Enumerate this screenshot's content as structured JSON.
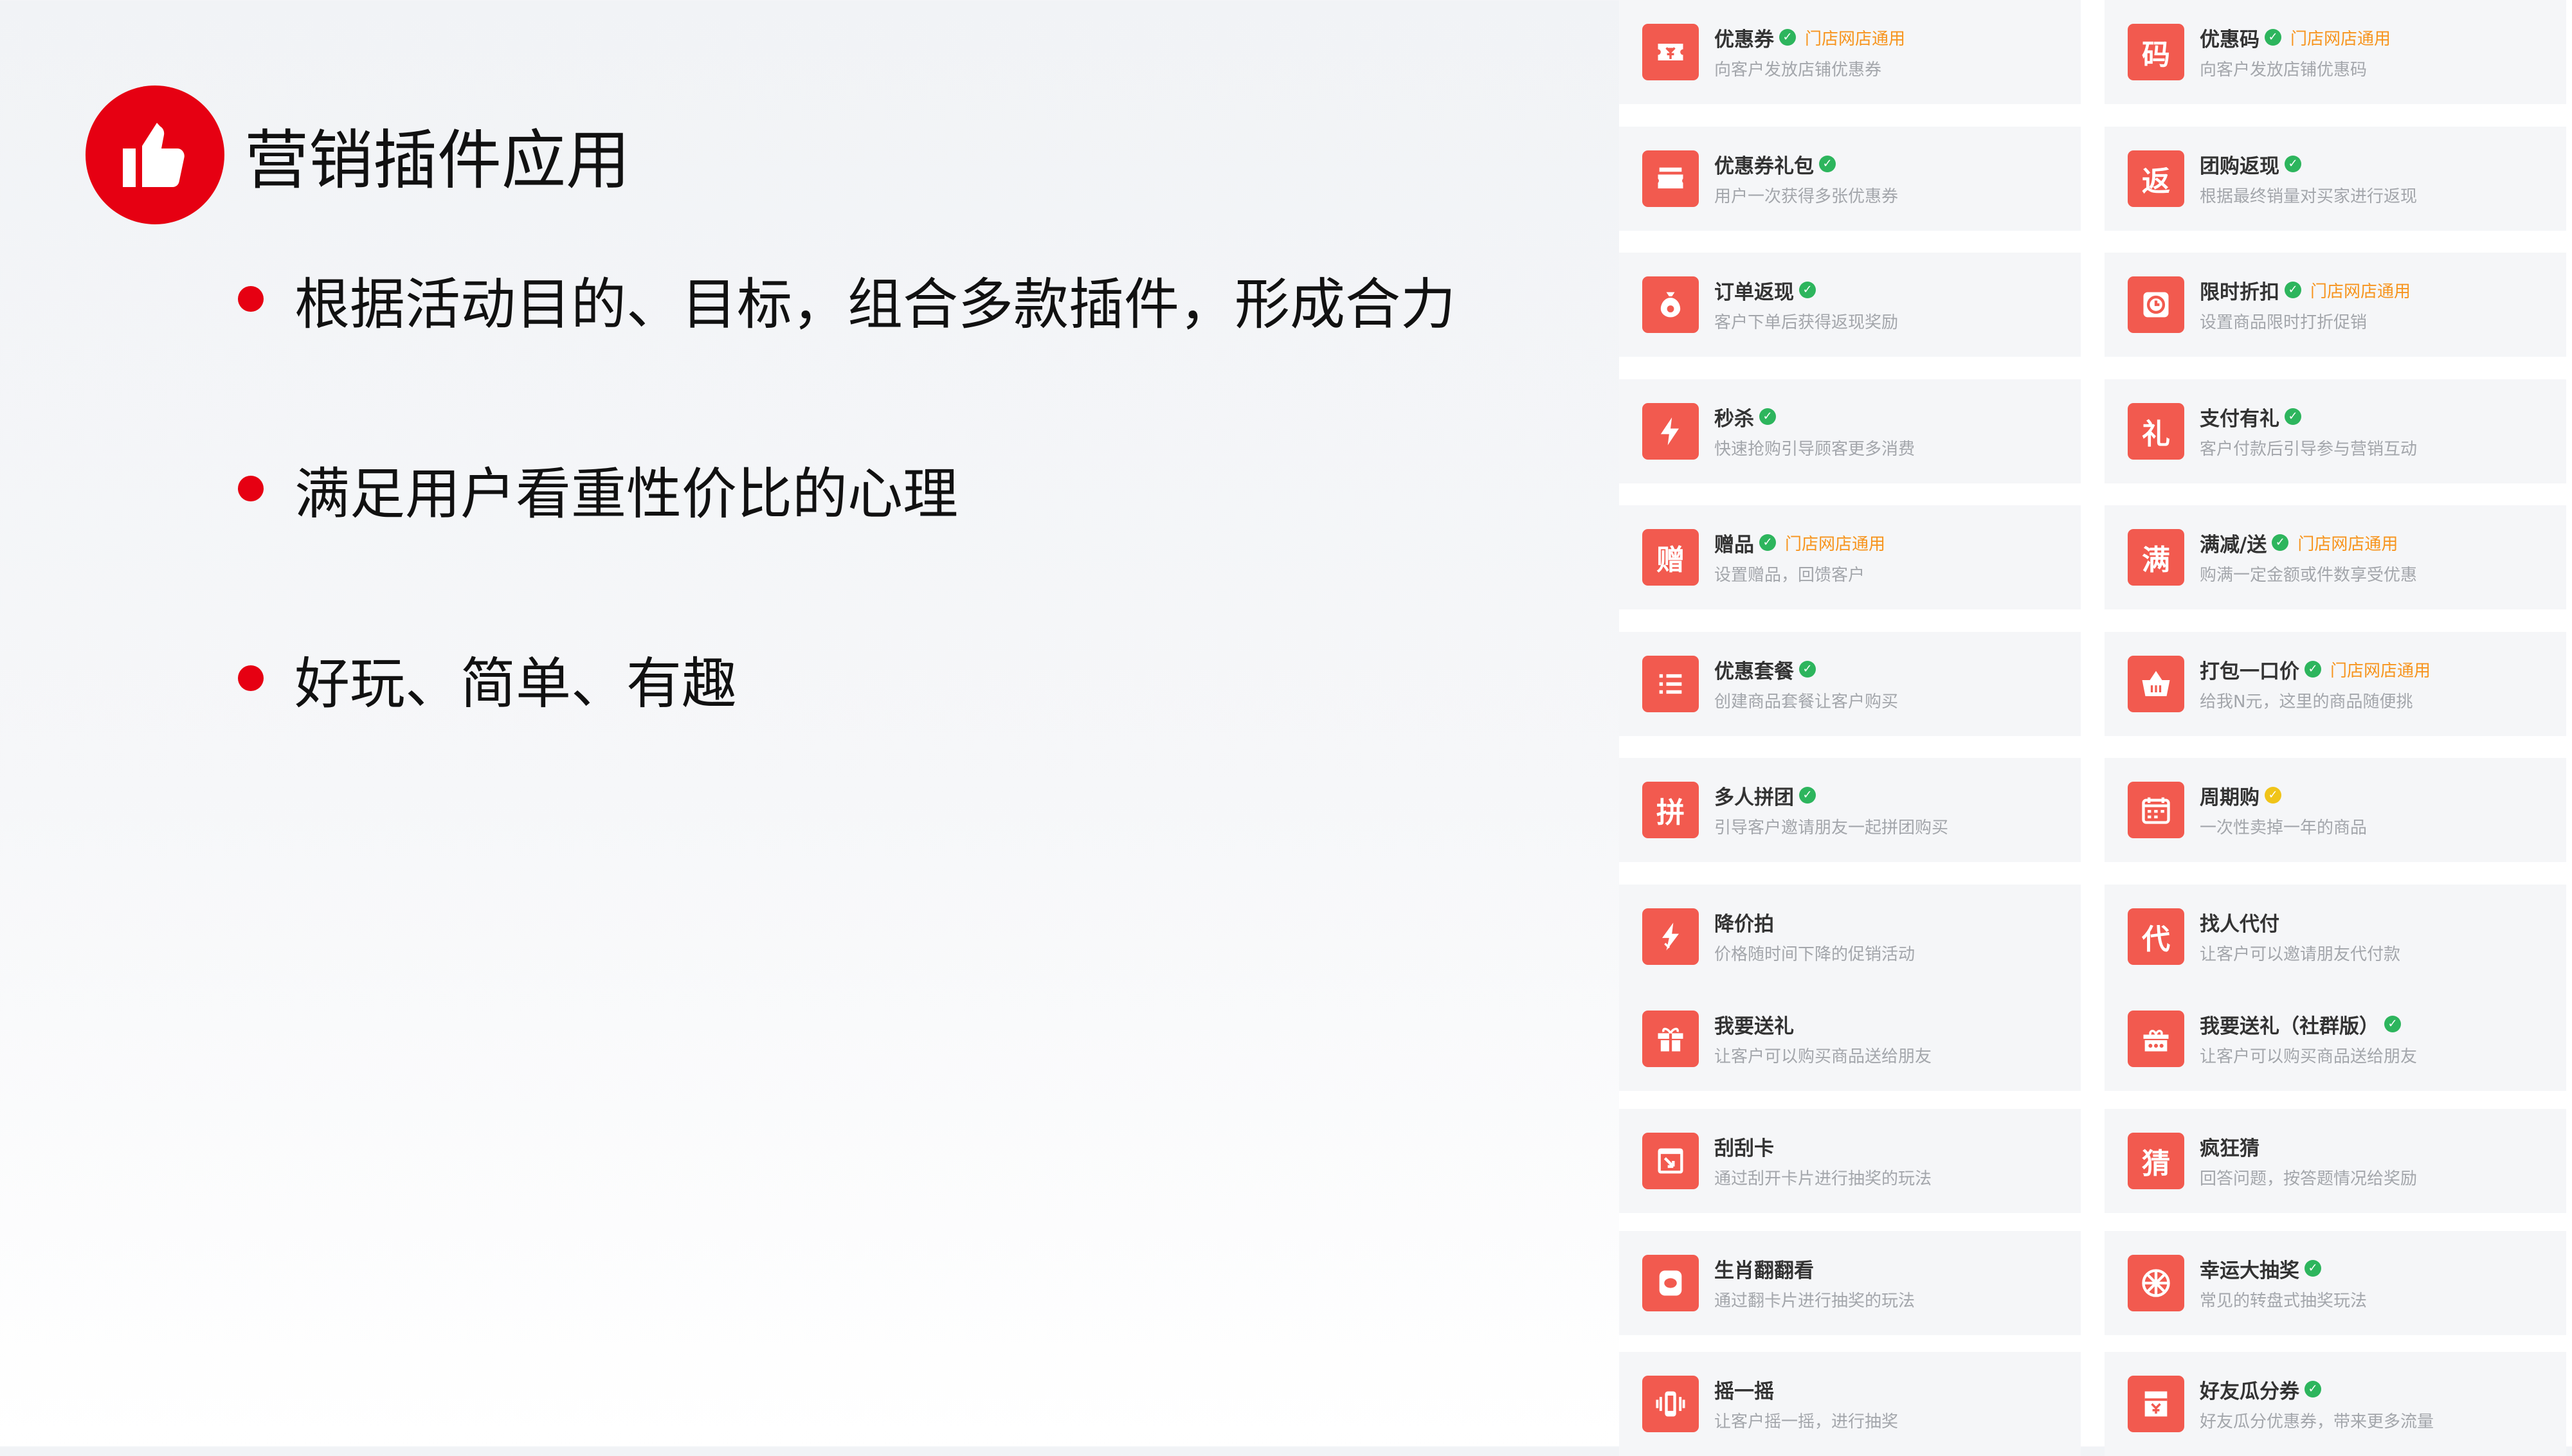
{
  "slide": {
    "title": "营销插件应用",
    "bullets": [
      "根据活动目的、目标，组合多款插件，形成合力",
      "满足用户看重性价比的心理",
      "好玩、简单、有趣"
    ]
  },
  "colors": {
    "accent": "#e60012",
    "icon_bg": "#f25a4f",
    "check_green": "#2db55d",
    "check_gold": "#f0c419",
    "tag_orange": "#f7941d"
  },
  "plugins": [
    {
      "name": "优惠券",
      "desc": "向客户发放店铺优惠券",
      "badge": "green",
      "tag": "门店网店通用",
      "icon": "ticket-icon",
      "glyph": ""
    },
    {
      "name": "优惠码",
      "desc": "向客户发放店铺优惠码",
      "badge": "green",
      "tag": "门店网店通用",
      "icon": "code-icon",
      "glyph": "码"
    },
    {
      "name": "优惠券礼包",
      "desc": "用户一次获得多张优惠券",
      "badge": "green",
      "tag": "",
      "icon": "coupon-pack-icon",
      "glyph": ""
    },
    {
      "name": "团购返现",
      "desc": "根据最终销量对买家进行返现",
      "badge": "green",
      "tag": "",
      "icon": "cashback-icon",
      "glyph": "返"
    },
    {
      "name": "订单返现",
      "desc": "客户下单后获得返现奖励",
      "badge": "green",
      "tag": "",
      "icon": "money-bag-icon",
      "glyph": ""
    },
    {
      "name": "限时折扣",
      "desc": "设置商品限时打折促销",
      "badge": "green",
      "tag": "门店网店通用",
      "icon": "clock-icon",
      "glyph": ""
    },
    {
      "name": "秒杀",
      "desc": "快速抢购引导顾客更多消费",
      "badge": "green",
      "tag": "",
      "icon": "lightning-icon",
      "glyph": ""
    },
    {
      "name": "支付有礼",
      "desc": "客户付款后引导参与营销互动",
      "badge": "green",
      "tag": "",
      "icon": "gift-char-icon",
      "glyph": "礼"
    },
    {
      "name": "赠品",
      "desc": "设置赠品，回馈客户",
      "badge": "green",
      "tag": "门店网店通用",
      "icon": "giveaway-icon",
      "glyph": "赠"
    },
    {
      "name": "满减/送",
      "desc": "购满一定金额或件数享受优惠",
      "badge": "green",
      "tag": "门店网店通用",
      "icon": "full-reduction-icon",
      "glyph": "满"
    },
    {
      "name": "优惠套餐",
      "desc": "创建商品套餐让客户购买",
      "badge": "green",
      "tag": "",
      "icon": "list-icon",
      "glyph": ""
    },
    {
      "name": "打包一口价",
      "desc": "给我N元，这里的商品随便挑",
      "badge": "green",
      "tag": "门店网店通用",
      "icon": "basket-icon",
      "glyph": ""
    },
    {
      "name": "多人拼团",
      "desc": "引导客户邀请朋友一起拼团购买",
      "badge": "green",
      "tag": "",
      "icon": "group-buy-icon",
      "glyph": "拼"
    },
    {
      "name": "周期购",
      "desc": "一次性卖掉一年的商品",
      "badge": "gold",
      "tag": "",
      "icon": "calendar-icon",
      "glyph": ""
    },
    {
      "name": "降价拍",
      "desc": "价格随时间下降的促销活动",
      "badge": "",
      "tag": "",
      "icon": "price-drop-icon",
      "glyph": ""
    },
    {
      "name": "找人代付",
      "desc": "让客户可以邀请朋友代付款",
      "badge": "",
      "tag": "",
      "icon": "proxy-pay-icon",
      "glyph": "代"
    },
    {
      "name": "我要送礼",
      "desc": "让客户可以购买商品送给朋友",
      "badge": "",
      "tag": "",
      "icon": "gift-box-icon",
      "glyph": ""
    },
    {
      "name": "我要送礼（社群版）",
      "desc": "让客户可以购买商品送给朋友",
      "badge": "green",
      "tag": "",
      "icon": "gift-group-icon",
      "glyph": ""
    },
    {
      "name": "刮刮卡",
      "desc": "通过刮开卡片进行抽奖的玩法",
      "badge": "",
      "tag": "",
      "icon": "scratch-card-icon",
      "glyph": ""
    },
    {
      "name": "疯狂猜",
      "desc": "回答问题，按答题情况给奖励",
      "badge": "",
      "tag": "",
      "icon": "guess-icon",
      "glyph": "猜"
    },
    {
      "name": "生肖翻翻看",
      "desc": "通过翻卡片进行抽奖的玩法",
      "badge": "",
      "tag": "",
      "icon": "flip-card-icon",
      "glyph": ""
    },
    {
      "name": "幸运大抽奖",
      "desc": "常见的转盘式抽奖玩法",
      "badge": "green",
      "tag": "",
      "icon": "wheel-icon",
      "glyph": ""
    },
    {
      "name": "摇一摇",
      "desc": "让客户摇一摇，进行抽奖",
      "badge": "",
      "tag": "",
      "icon": "shake-icon",
      "glyph": ""
    },
    {
      "name": "好友瓜分券",
      "desc": "好友瓜分优惠券，带来更多流量",
      "badge": "green",
      "tag": "",
      "icon": "split-coupon-icon",
      "glyph": ""
    }
  ]
}
